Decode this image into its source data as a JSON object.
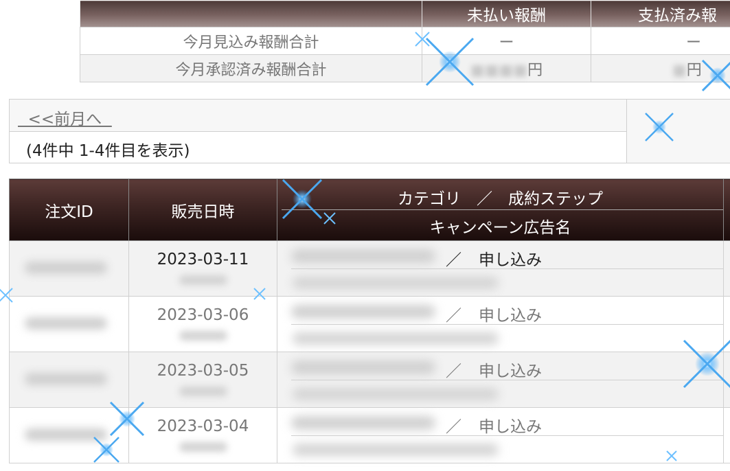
{
  "summary": {
    "headers": [
      "",
      "未払い報酬",
      "支払済み報"
    ],
    "rows": [
      {
        "label": "今月見込み報酬合計",
        "unpaid": "ー",
        "paid": "ー"
      },
      {
        "label": "今月承認済み報酬合計",
        "unpaid_suffix": "円",
        "paid_suffix": "円"
      }
    ]
  },
  "pager": {
    "prev_link": "  <<前月へ  ",
    "count_text": "(4件中 1-4件目を表示)"
  },
  "results": {
    "headers": {
      "order_id": "注文ID",
      "sale_datetime": "販売日時",
      "category_step": "カテゴリ　／　成約ステップ",
      "campaign": "キャンペーン広告名"
    },
    "rows": [
      {
        "date": "2023-03-11",
        "separator": "／",
        "step": "申し込み"
      },
      {
        "date": "2023-03-06",
        "separator": "／",
        "step": "申し込み"
      },
      {
        "date": "2023-03-05",
        "separator": "／",
        "step": "申し込み"
      },
      {
        "date": "2023-03-04",
        "separator": "／",
        "step": "申し込み"
      }
    ]
  },
  "colors": {
    "header_dark": "#2a1716",
    "header_summary": "#7a6361",
    "border": "#cfcfcf",
    "sparkle": "#4aa8f0"
  }
}
